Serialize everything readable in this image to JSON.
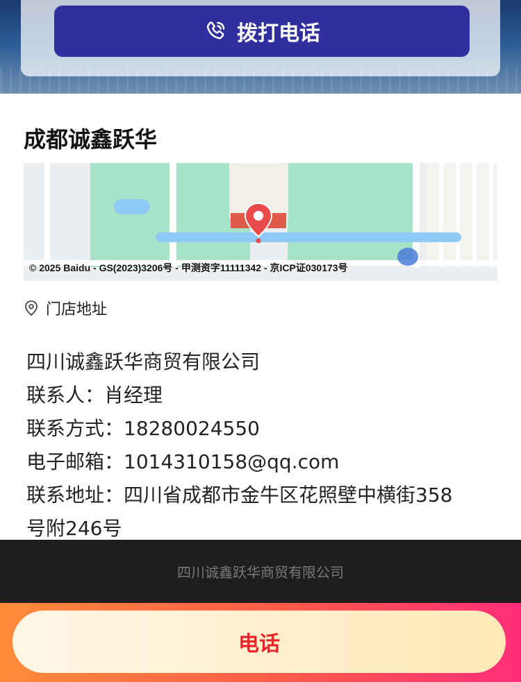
{
  "top": {
    "call_label": "拨打电话"
  },
  "store": {
    "name": "成都诚鑫跃华"
  },
  "map": {
    "copyright": "© 2025 Baidu - GS(2023)3206号 - 甲测资字11111342 - 京ICP证030173号"
  },
  "address_section": {
    "label": "门店地址"
  },
  "company": {
    "name": "四川诚鑫跃华商贸有限公司",
    "contact": "联系人：肖经理",
    "phone": "联系方式：18280024550",
    "email": "电子邮箱：1014310158@qq.com",
    "address_line1": "联系地址：四川省成都市金牛区花照壁中横街358",
    "address_line2": "号附246号"
  },
  "footer": {
    "text": "四川诚鑫跃华商贸有限公司"
  },
  "bottom_bar": {
    "call_label": "电话"
  },
  "colors": {
    "call_button": "#2f2fa0",
    "bottom_bar_start": "#ff8c3a",
    "bottom_bar_end": "#ff2d7a",
    "bottom_button_text": "#e8262a",
    "footer_bg": "#1e1e1e"
  },
  "icons": {
    "call": "phone-icon",
    "location": "location-pin-icon",
    "map_marker": "map-marker-icon"
  }
}
